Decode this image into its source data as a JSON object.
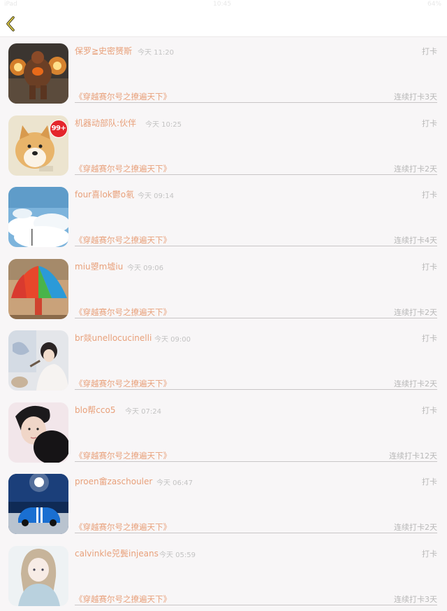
{
  "status_bar": {
    "carrier": "iPad",
    "time": "10:45",
    "battery": "64%"
  },
  "rows": [
    {
      "name": "保罗≧史密赟斯",
      "time": "今天 11:20",
      "action": "打卡",
      "book": "《穿越赛尔号之撩遍天下》",
      "streak": "连续打卡3天",
      "avatar": "fire-monster",
      "badge": ""
    },
    {
      "name": "机器动部队:伙伴",
      "time": "今天 10:25",
      "action": "打卡",
      "book": "《穿越赛尔号之撩遍天下》",
      "streak": "连续打卡2天",
      "avatar": "shiba-dog",
      "badge": "99+"
    },
    {
      "name": "four喜lok鬱o氡",
      "time": "今天 09:14",
      "action": "打卡",
      "book": "《穿越赛尔号之撩遍天下》",
      "streak": "连续打卡4天",
      "avatar": "sky-clouds",
      "badge": ""
    },
    {
      "name": "miu曌m墟iu",
      "time": "今天 09:06",
      "action": "打卡",
      "book": "《穿越赛尔号之撩遍天下》",
      "streak": "连续打卡2天",
      "avatar": "rainbow-umbrella",
      "badge": ""
    },
    {
      "name": "br燚unellocucinelli",
      "time": "今天 09:00",
      "action": "打卡",
      "book": "《穿越赛尔号之撩遍天下》",
      "streak": "连续打卡2天",
      "avatar": "girl-painting",
      "badge": ""
    },
    {
      "name": "blo帮cco5",
      "time": "今天 07:24",
      "action": "打卡",
      "book": "《穿越赛尔号之撩遍天下》",
      "streak": "连续打卡12天",
      "avatar": "boy-portrait",
      "badge": ""
    },
    {
      "name": "proen畲zaschouler",
      "time": "今天 06:47",
      "action": "打卡",
      "book": "《穿越赛尔号之撩遍天下》",
      "streak": "连续打卡2天",
      "avatar": "blue-car",
      "badge": ""
    },
    {
      "name": "calvinkle兕鬓injeans",
      "time": "今天 05:59",
      "action": "打卡",
      "book": "《穿越赛尔号之撩遍天下》",
      "streak": "连续打卡3天",
      "avatar": "anime-girl",
      "badge": ""
    }
  ]
}
